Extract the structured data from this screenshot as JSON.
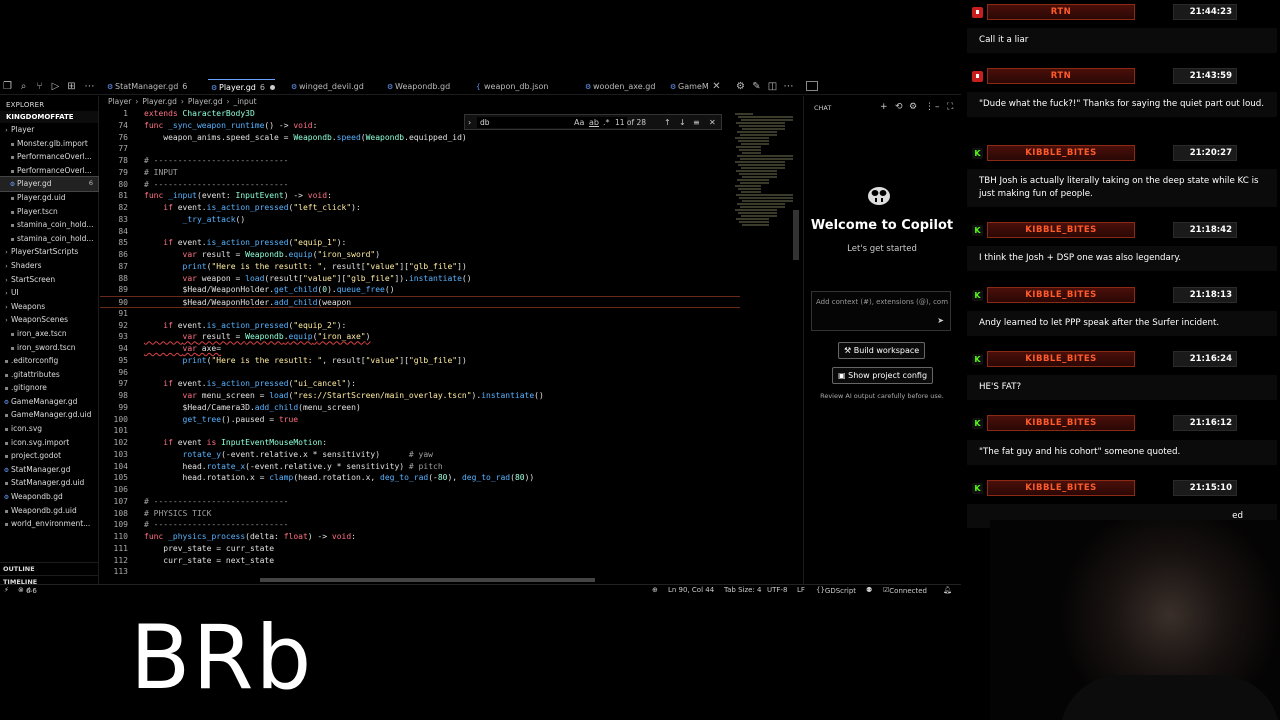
{
  "editor": {
    "tabs": [
      {
        "label": "StatManager.gd",
        "num": "6",
        "dirty": false,
        "active": false
      },
      {
        "label": "Player.gd",
        "num": "6",
        "dirty": true,
        "active": true
      },
      {
        "label": "winged_devil.gd",
        "num": "",
        "dirty": false,
        "active": false
      },
      {
        "label": "Weapondb.gd",
        "num": "",
        "dirty": false,
        "active": false
      },
      {
        "label": "weapon_db.json",
        "num": "",
        "dirty": false,
        "active": false
      },
      {
        "label": "wooden_axe.gd",
        "num": "",
        "dirty": false,
        "active": false
      },
      {
        "label": "GameM",
        "num": "",
        "dirty": false,
        "active": false
      }
    ],
    "explorer": {
      "title": "EXPLORER",
      "root": "KINGDOMOFFATE",
      "items": [
        {
          "label": "Player",
          "kind": "folder",
          "badge": ""
        },
        {
          "label": "Monster.glb.import",
          "kind": "file",
          "badge": ""
        },
        {
          "label": "PerformanceOverl...",
          "kind": "file",
          "badge": ""
        },
        {
          "label": "PerformanceOverl...",
          "kind": "file",
          "badge": ""
        },
        {
          "label": "Player.gd",
          "kind": "gd",
          "badge": "6",
          "selected": true
        },
        {
          "label": "Player.gd.uid",
          "kind": "file",
          "badge": ""
        },
        {
          "label": "Player.tscn",
          "kind": "file",
          "badge": ""
        },
        {
          "label": "stamina_coin_hold...",
          "kind": "file",
          "badge": ""
        },
        {
          "label": "stamina_coin_hold...",
          "kind": "file",
          "badge": ""
        },
        {
          "label": "PlayerStartScripts",
          "kind": "folder",
          "badge": ""
        },
        {
          "label": "Shaders",
          "kind": "folder",
          "badge": ""
        },
        {
          "label": "StartScreen",
          "kind": "folder",
          "badge": ""
        },
        {
          "label": "UI",
          "kind": "folder",
          "badge": ""
        },
        {
          "label": "Weapons",
          "kind": "folder",
          "badge": ""
        },
        {
          "label": "WeaponScenes",
          "kind": "folder",
          "badge": ""
        },
        {
          "label": "iron_axe.tscn",
          "kind": "file",
          "badge": ""
        },
        {
          "label": "iron_sword.tscn",
          "kind": "file",
          "badge": ""
        },
        {
          "label": ".editorconfig",
          "kind": "file",
          "badge": ""
        },
        {
          "label": ".gitattributes",
          "kind": "file",
          "badge": ""
        },
        {
          "label": ".gitignore",
          "kind": "file",
          "badge": ""
        },
        {
          "label": "GameManager.gd",
          "kind": "gd",
          "badge": ""
        },
        {
          "label": "GameManager.gd.uid",
          "kind": "file",
          "badge": ""
        },
        {
          "label": "icon.svg",
          "kind": "file",
          "badge": ""
        },
        {
          "label": "icon.svg.import",
          "kind": "file",
          "badge": ""
        },
        {
          "label": "project.godot",
          "kind": "file",
          "badge": ""
        },
        {
          "label": "StatManager.gd",
          "kind": "gd",
          "badge": ""
        },
        {
          "label": "StatManager.gd.uid",
          "kind": "file",
          "badge": ""
        },
        {
          "label": "Weapondb.gd",
          "kind": "gd",
          "badge": ""
        },
        {
          "label": "Weapondb.gd.uid",
          "kind": "file",
          "badge": ""
        },
        {
          "label": "world_environment...",
          "kind": "file",
          "badge": ""
        }
      ],
      "outline": "OUTLINE",
      "timeline": "TIMELINE"
    },
    "breadcrumb": [
      "Player",
      "Player.gd",
      "Player.gd",
      "_input"
    ],
    "find": {
      "query": "db",
      "count": "11 of 28"
    },
    "code": [
      {
        "n": "1",
        "t": "extends CharacterBody3D"
      },
      {
        "n": "74",
        "t": "func _sync_weapon_runtime() -> void:"
      },
      {
        "n": "76",
        "t": "    weapon_anims.speed_scale = Weapondb.speed(Weapondb.equipped_id)"
      },
      {
        "n": "77",
        "t": ""
      },
      {
        "n": "78",
        "t": "# ----------------------------"
      },
      {
        "n": "79",
        "t": "# INPUT"
      },
      {
        "n": "80",
        "t": "# ----------------------------"
      },
      {
        "n": "81",
        "t": "func _input(event: InputEvent) -> void:"
      },
      {
        "n": "82",
        "t": "    if event.is_action_pressed(\"left_click\"):"
      },
      {
        "n": "83",
        "t": "        _try_attack()"
      },
      {
        "n": "84",
        "t": ""
      },
      {
        "n": "85",
        "t": "    if event.is_action_pressed(\"equip_1\"):"
      },
      {
        "n": "86",
        "t": "        var result = Weapondb.equip(\"iron_sword\")"
      },
      {
        "n": "87",
        "t": "        print(\"Here is the resutlt: \", result[\"value\"][\"glb_file\"])"
      },
      {
        "n": "88",
        "t": "        var weapon = load(result[\"value\"][\"glb_file\"]).instantiate()"
      },
      {
        "n": "89",
        "t": "        $Head/WeaponHolder.get_child(0).queue_free()"
      },
      {
        "n": "90",
        "t": "        $Head/WeaponHolder.add_child(weapon"
      },
      {
        "n": "91",
        "t": ""
      },
      {
        "n": "92",
        "t": "    if event.is_action_pressed(\"equip_2\"):"
      },
      {
        "n": "93",
        "t": "        var result = Weapondb.equip(\"iron_axe\")"
      },
      {
        "n": "94",
        "t": "        var axe="
      },
      {
        "n": "95",
        "t": "        print(\"Here is the resutlt: \", result[\"value\"][\"glb_file\"])"
      },
      {
        "n": "96",
        "t": ""
      },
      {
        "n": "97",
        "t": "    if event.is_action_pressed(\"ui_cancel\"):"
      },
      {
        "n": "98",
        "t": "        var menu_screen = load(\"res://StartScreen/main_overlay.tscn\").instantiate()"
      },
      {
        "n": "99",
        "t": "        $Head/Camera3D.add_child(menu_screen)"
      },
      {
        "n": "100",
        "t": "        get_tree().paused = true"
      },
      {
        "n": "101",
        "t": ""
      },
      {
        "n": "102",
        "t": "    if event is InputEventMouseMotion:"
      },
      {
        "n": "103",
        "t": "        rotate_y(-event.relative.x * sensitivity)      # yaw"
      },
      {
        "n": "104",
        "t": "        head.rotate_x(-event.relative.y * sensitivity) # pitch"
      },
      {
        "n": "105",
        "t": "        head.rotation.x = clamp(head.rotation.x, deg_to_rad(-80), deg_to_rad(80))"
      },
      {
        "n": "106",
        "t": ""
      },
      {
        "n": "107",
        "t": "# ----------------------------"
      },
      {
        "n": "108",
        "t": "# PHYSICS TICK"
      },
      {
        "n": "109",
        "t": "# ----------------------------"
      },
      {
        "n": "110",
        "t": "func _physics_process(delta: float) -> void:"
      },
      {
        "n": "111",
        "t": "    prev_state = curr_state"
      },
      {
        "n": "112",
        "t": "    curr_state = next_state"
      },
      {
        "n": "113",
        "t": ""
      }
    ],
    "chat_panel": {
      "title": "CHAT",
      "welcome": "Welcome to Copilot",
      "subtitle": "Let's get started",
      "input_placeholder": "Add context (#), extensions (@), com",
      "build_button": "Build workspace",
      "config_button": "Show project config",
      "review": "Review AI output carefully before use."
    },
    "status": {
      "errors": "6",
      "warnings": "6",
      "position": "Ln 90, Col 44",
      "tab_size": "Tab Size: 4",
      "encoding": "UTF-8",
      "eol": "LF",
      "language": "GDScript",
      "connection": "Connected"
    }
  },
  "overlay_text": "BRb",
  "stream_chat": [
    {
      "platform": "youtube",
      "user": "RTN",
      "time": "21:44:23",
      "message": "Call it a liar"
    },
    {
      "platform": "youtube",
      "user": "RTN",
      "time": "21:43:59",
      "message": "\"Dude what the fuck?!\" Thanks for saying the quiet part out loud."
    },
    {
      "platform": "kick",
      "user": "KIBBLE_BITES",
      "time": "21:20:27",
      "message": "TBH Josh is actually literally taking on the deep state while KC is just making fun of people."
    },
    {
      "platform": "kick",
      "user": "KIBBLE_BITES",
      "time": "21:18:42",
      "message": "I think the Josh + DSP one was also legendary."
    },
    {
      "platform": "kick",
      "user": "KIBBLE_BITES",
      "time": "21:18:13",
      "message": "Andy learned to let PPP speak after the Surfer incident."
    },
    {
      "platform": "kick",
      "user": "KIBBLE_BITES",
      "time": "21:16:24",
      "message": "HE'S FAT?"
    },
    {
      "platform": "kick",
      "user": "KIBBLE_BITES",
      "time": "21:16:12",
      "message": "\"The fat guy and his cohort\" someone quoted."
    },
    {
      "platform": "kick",
      "user": "KIBBLE_BITES",
      "time": "21:15:10",
      "message": "ed"
    }
  ],
  "colors": {
    "accent": "#6aa0ff",
    "username": "#ff5a2a",
    "kick": "#53fc18",
    "youtube": "#c81e1e"
  }
}
